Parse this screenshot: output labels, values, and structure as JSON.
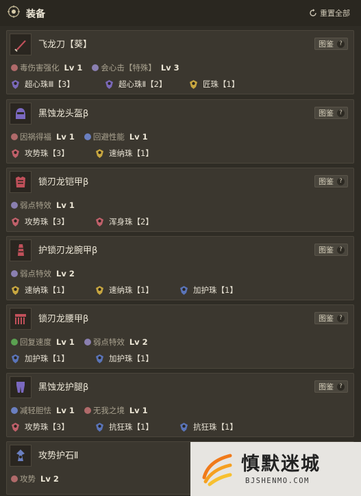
{
  "header": {
    "title": "装备",
    "reset_label": "重置全部"
  },
  "reference_label": "图鉴",
  "reference_help": "?",
  "equipment": [
    {
      "name": "飞龙刀【葵】",
      "skills": [
        {
          "name": "毒伤害强化",
          "level": "Lv 1",
          "color": "#b06a6a"
        },
        {
          "name": "会心击【特殊】",
          "level": "Lv 3",
          "color": "#8a7fb0"
        }
      ],
      "decorations": [
        {
          "name": "超心珠Ⅲ【3】",
          "color": "#7a68b8"
        },
        {
          "name": "超心珠Ⅱ【2】",
          "color": "#7a68b8"
        },
        {
          "name": "匠珠【1】",
          "color": "#c7a640"
        }
      ]
    },
    {
      "name": "黑蚀龙头盔β",
      "skills": [
        {
          "name": "因祸得福",
          "level": "Lv 1",
          "color": "#b06a6a"
        },
        {
          "name": "回避性能",
          "level": "Lv 1",
          "color": "#6a7fc0"
        }
      ],
      "decorations": [
        {
          "name": "攻势珠【3】",
          "color": "#c0606a"
        },
        {
          "name": "速纳珠【1】",
          "color": "#c7a640"
        }
      ]
    },
    {
      "name": "锁刃龙铠甲β",
      "skills": [
        {
          "name": "弱点特效",
          "level": "Lv 1",
          "color": "#8a7fb0"
        }
      ],
      "decorations": [
        {
          "name": "攻势珠【3】",
          "color": "#c0606a"
        },
        {
          "name": "浑身珠【2】",
          "color": "#c0606a"
        }
      ]
    },
    {
      "name": "护锁刃龙腕甲β",
      "skills": [
        {
          "name": "弱点特效",
          "level": "Lv 2",
          "color": "#8a7fb0"
        }
      ],
      "decorations": [
        {
          "name": "速纳珠【1】",
          "color": "#c7a640"
        },
        {
          "name": "速纳珠【1】",
          "color": "#c7a640"
        },
        {
          "name": "加护珠【1】",
          "color": "#5a74b8"
        }
      ]
    },
    {
      "name": "锁刃龙腰甲β",
      "skills": [
        {
          "name": "回复速度",
          "level": "Lv 1",
          "color": "#5aa050"
        },
        {
          "name": "弱点特效",
          "level": "Lv 2",
          "color": "#8a7fb0"
        }
      ],
      "decorations": [
        {
          "name": "加护珠【1】",
          "color": "#5a74b8"
        },
        {
          "name": "加护珠【1】",
          "color": "#5a74b8"
        }
      ]
    },
    {
      "name": "黑蚀龙护腿β",
      "skills": [
        {
          "name": "减轻胆怯",
          "level": "Lv 1",
          "color": "#6a7fc0"
        },
        {
          "name": "无我之境",
          "level": "Lv 1",
          "color": "#b06a6a"
        }
      ],
      "decorations": [
        {
          "name": "攻势珠【3】",
          "color": "#c0606a"
        },
        {
          "name": "抗狂珠【1】",
          "color": "#5a74b8"
        },
        {
          "name": "抗狂珠【1】",
          "color": "#5a74b8"
        }
      ]
    },
    {
      "name": "攻势护石Ⅱ",
      "skills": [
        {
          "name": "攻势",
          "level": "Lv 2",
          "color": "#b06a6a"
        }
      ],
      "decorations": []
    }
  ],
  "watermark": {
    "text": "慎默迷城",
    "url": "BJSHENMO.COM"
  }
}
